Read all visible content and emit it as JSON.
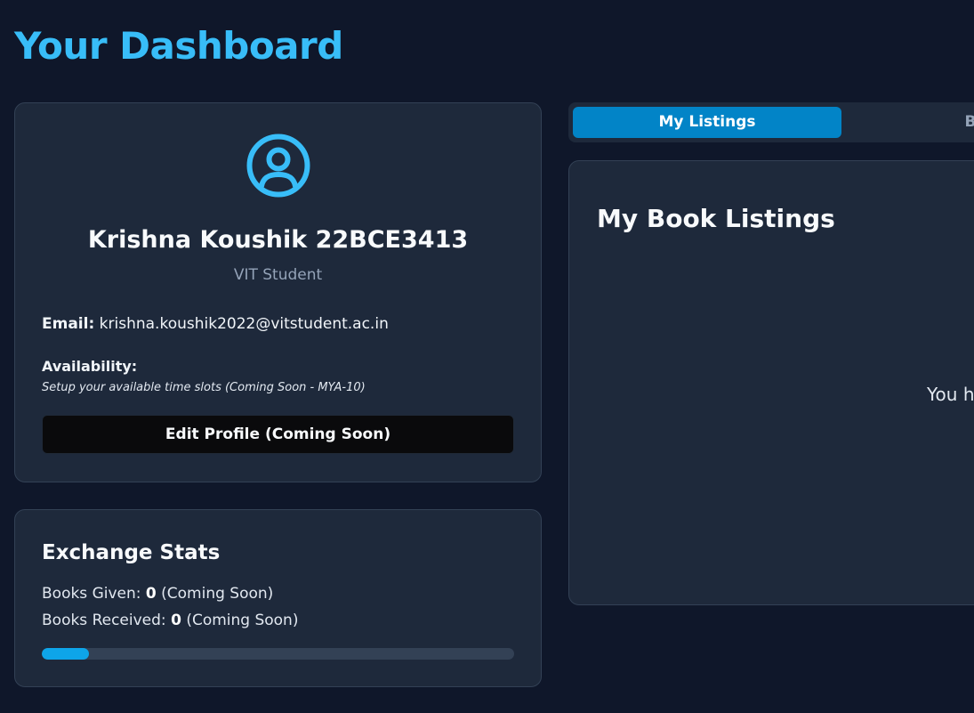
{
  "header": {
    "title": "Your Dashboard"
  },
  "profile": {
    "name": "Krishna Koushik 22BCE3413",
    "role": "VIT Student",
    "email_label": "Email:",
    "email": "krishna.koushik2022@vitstudent.ac.in",
    "availability_label": "Availability:",
    "availability_note": "Setup your available time slots (Coming Soon - MYA-10)",
    "edit_button": "Edit Profile (Coming Soon)",
    "avatar_icon": "user-circle-icon",
    "accent_color": "#38bdf8"
  },
  "stats": {
    "title": "Exchange Stats",
    "given_label": "Books Given:",
    "given_value": "0",
    "given_suffix": "(Coming Soon)",
    "received_label": "Books Received:",
    "received_value": "0",
    "received_suffix": "(Coming Soon)",
    "progress_fraction": 0.1
  },
  "tabs": [
    {
      "label": "My Listings",
      "active": true
    },
    {
      "label": "Bro",
      "active": false
    }
  ],
  "listings": {
    "title": "My Book Listings",
    "empty_message": "You h"
  }
}
